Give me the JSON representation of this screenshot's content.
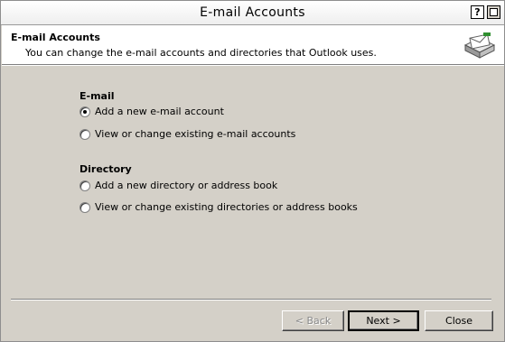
{
  "window": {
    "title": "E-mail Accounts"
  },
  "titlebar_buttons": {
    "help": "?"
  },
  "header": {
    "title": "E-mail Accounts",
    "subtitle": "You can change the e-mail accounts and directories that Outlook uses.",
    "icon": "email-accounts-icon"
  },
  "email_group": {
    "label": "E-mail",
    "options": [
      {
        "label": "Add a new e-mail account",
        "selected": true
      },
      {
        "label": "View or change existing e-mail accounts",
        "selected": false
      }
    ]
  },
  "directory_group": {
    "label": "Directory",
    "options": [
      {
        "label": "Add a new directory or address book",
        "selected": false
      },
      {
        "label": "View or change existing directories or address books",
        "selected": false
      }
    ]
  },
  "buttons": {
    "back": "< Back",
    "next": "Next >",
    "close": "Close"
  }
}
